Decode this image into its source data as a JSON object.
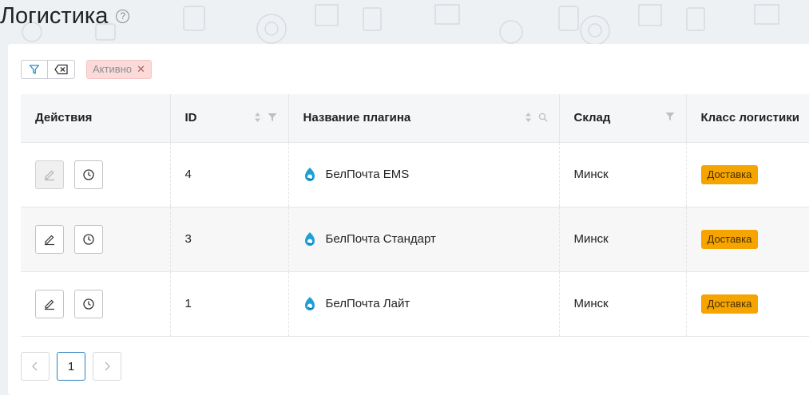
{
  "page": {
    "title": "Логистика",
    "help_glyph": "?"
  },
  "filters": {
    "active_tag": "Активно",
    "tag_close_glyph": "✕"
  },
  "table": {
    "columns": [
      {
        "label": "Действия"
      },
      {
        "label": "ID"
      },
      {
        "label": "Название плагина"
      },
      {
        "label": "Склад"
      },
      {
        "label": "Класс логистики"
      }
    ],
    "rows": [
      {
        "id": "4",
        "plugin": "БелПочта EMS",
        "warehouse": "Минск",
        "class": "Доставка",
        "edit_disabled": true
      },
      {
        "id": "3",
        "plugin": "БелПочта Стандарт",
        "warehouse": "Минск",
        "class": "Доставка",
        "edit_disabled": false
      },
      {
        "id": "1",
        "plugin": "БелПочта Лайт",
        "warehouse": "Минск",
        "class": "Доставка",
        "edit_disabled": false
      }
    ]
  },
  "pagination": {
    "current_page": "1"
  },
  "colors": {
    "badge": "#f5a400",
    "tag_bg": "#fbdada",
    "active_page_border": "#2a7fbf"
  }
}
